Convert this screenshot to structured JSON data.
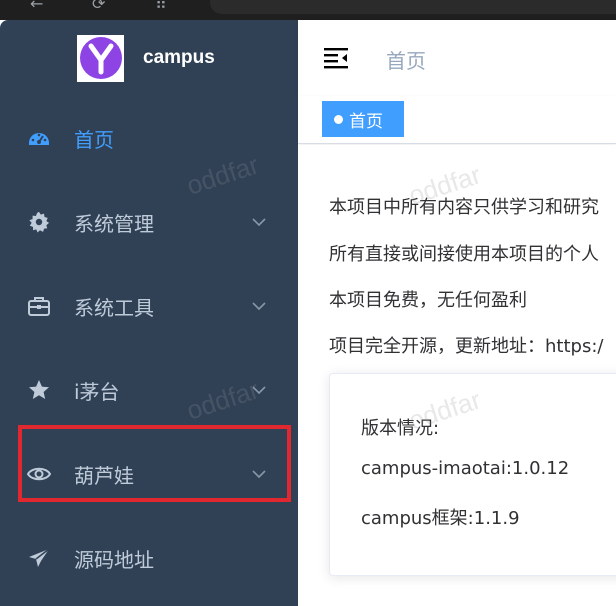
{
  "app": {
    "name": "campus"
  },
  "sidebar": {
    "items": [
      {
        "label": "首页",
        "icon": "dashboard-icon",
        "active": true
      },
      {
        "label": "系统管理",
        "icon": "gear-icon"
      },
      {
        "label": "系统工具",
        "icon": "toolbox-icon"
      },
      {
        "label": "i茅台",
        "icon": "star-icon"
      },
      {
        "label": "葫芦娃",
        "icon": "eye-icon"
      },
      {
        "label": "源码地址",
        "icon": "paper-plane-icon"
      }
    ]
  },
  "header": {
    "breadcrumb": "首页"
  },
  "tags": [
    {
      "label": "首页"
    }
  ],
  "content": {
    "paragraphs": [
      "本项目中所有内容只供学习和研究",
      "所有直接或间接使用本项目的个人",
      "本项目免费，无任何盈利",
      "项目完全开源，更新地址：https:/"
    ],
    "card": {
      "title": "版本情况:",
      "lines": [
        "campus-imaotai:1.0.12",
        "campus框架:1.1.9"
      ]
    }
  },
  "watermark": "oddfar",
  "colors": {
    "sidebar_bg": "#304156",
    "sidebar_text": "#bfcbd9",
    "active": "#409eff",
    "tag_bg": "#409eff",
    "highlight": "#e0282e"
  }
}
